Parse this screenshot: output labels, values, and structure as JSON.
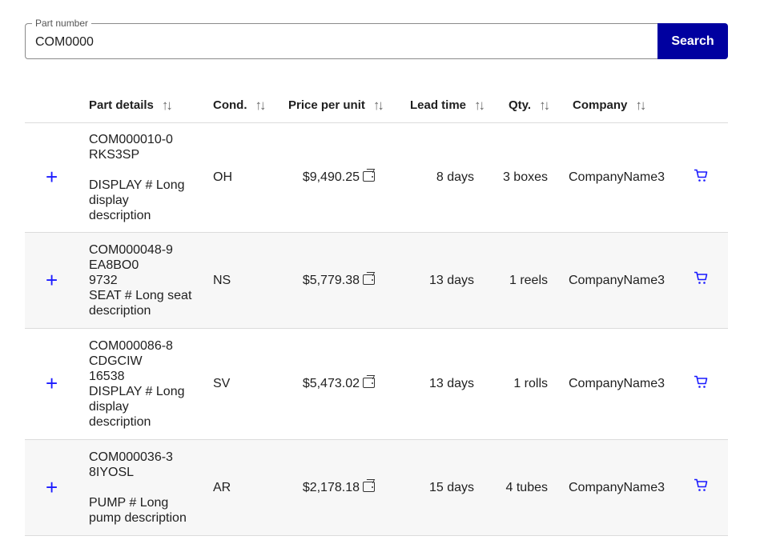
{
  "search": {
    "label": "Part number",
    "value": "COM0000",
    "button_label": "Search"
  },
  "table": {
    "columns": [
      {
        "label": "Part details",
        "sort_icon": "sort-icon"
      },
      {
        "label": "Cond.",
        "sort_icon": "sort-icon"
      },
      {
        "label": "Price per unit",
        "sort_icon": "sort-icon"
      },
      {
        "label": "Lead time",
        "sort_icon": "sort-icon"
      },
      {
        "label": "Qty.",
        "sort_icon": "sort-icon"
      },
      {
        "label": "Company",
        "sort_icon": "sort-icon"
      }
    ],
    "rows": [
      {
        "details": [
          "COM000010-0",
          "RKS3SP",
          "",
          "DISPLAY # Long",
          "display",
          "description"
        ],
        "condition": "OH",
        "price": "$9,490.25",
        "lead_time": "8 days",
        "qty": "3 boxes",
        "company": "CompanyName3"
      },
      {
        "details": [
          "COM000048-9",
          "EA8BO0",
          "9732",
          "SEAT # Long seat",
          "description"
        ],
        "condition": "NS",
        "price": "$5,779.38",
        "lead_time": "13 days",
        "qty": "1 reels",
        "company": "CompanyName3"
      },
      {
        "details": [
          "COM000086-8",
          "CDGCIW",
          "16538",
          "DISPLAY # Long",
          "display",
          "description"
        ],
        "condition": "SV",
        "price": "$5,473.02",
        "lead_time": "13 days",
        "qty": "1 rolls",
        "company": "CompanyName3"
      },
      {
        "details": [
          "COM000036-3",
          "8IYOSL",
          "",
          "PUMP # Long",
          "pump description"
        ],
        "condition": "AR",
        "price": "$2,178.18",
        "lead_time": "15 days",
        "qty": "4 tubes",
        "company": "CompanyName3"
      }
    ]
  },
  "icons": {
    "expand": "plus-icon",
    "price": "wallet-icon",
    "cart": "cart-icon",
    "sort": "sort-icon"
  },
  "colors": {
    "accent": "#0000a0",
    "icon_blue": "#1a1aff",
    "stripe": "#f7f7f7",
    "divider": "#dcdcdc"
  }
}
